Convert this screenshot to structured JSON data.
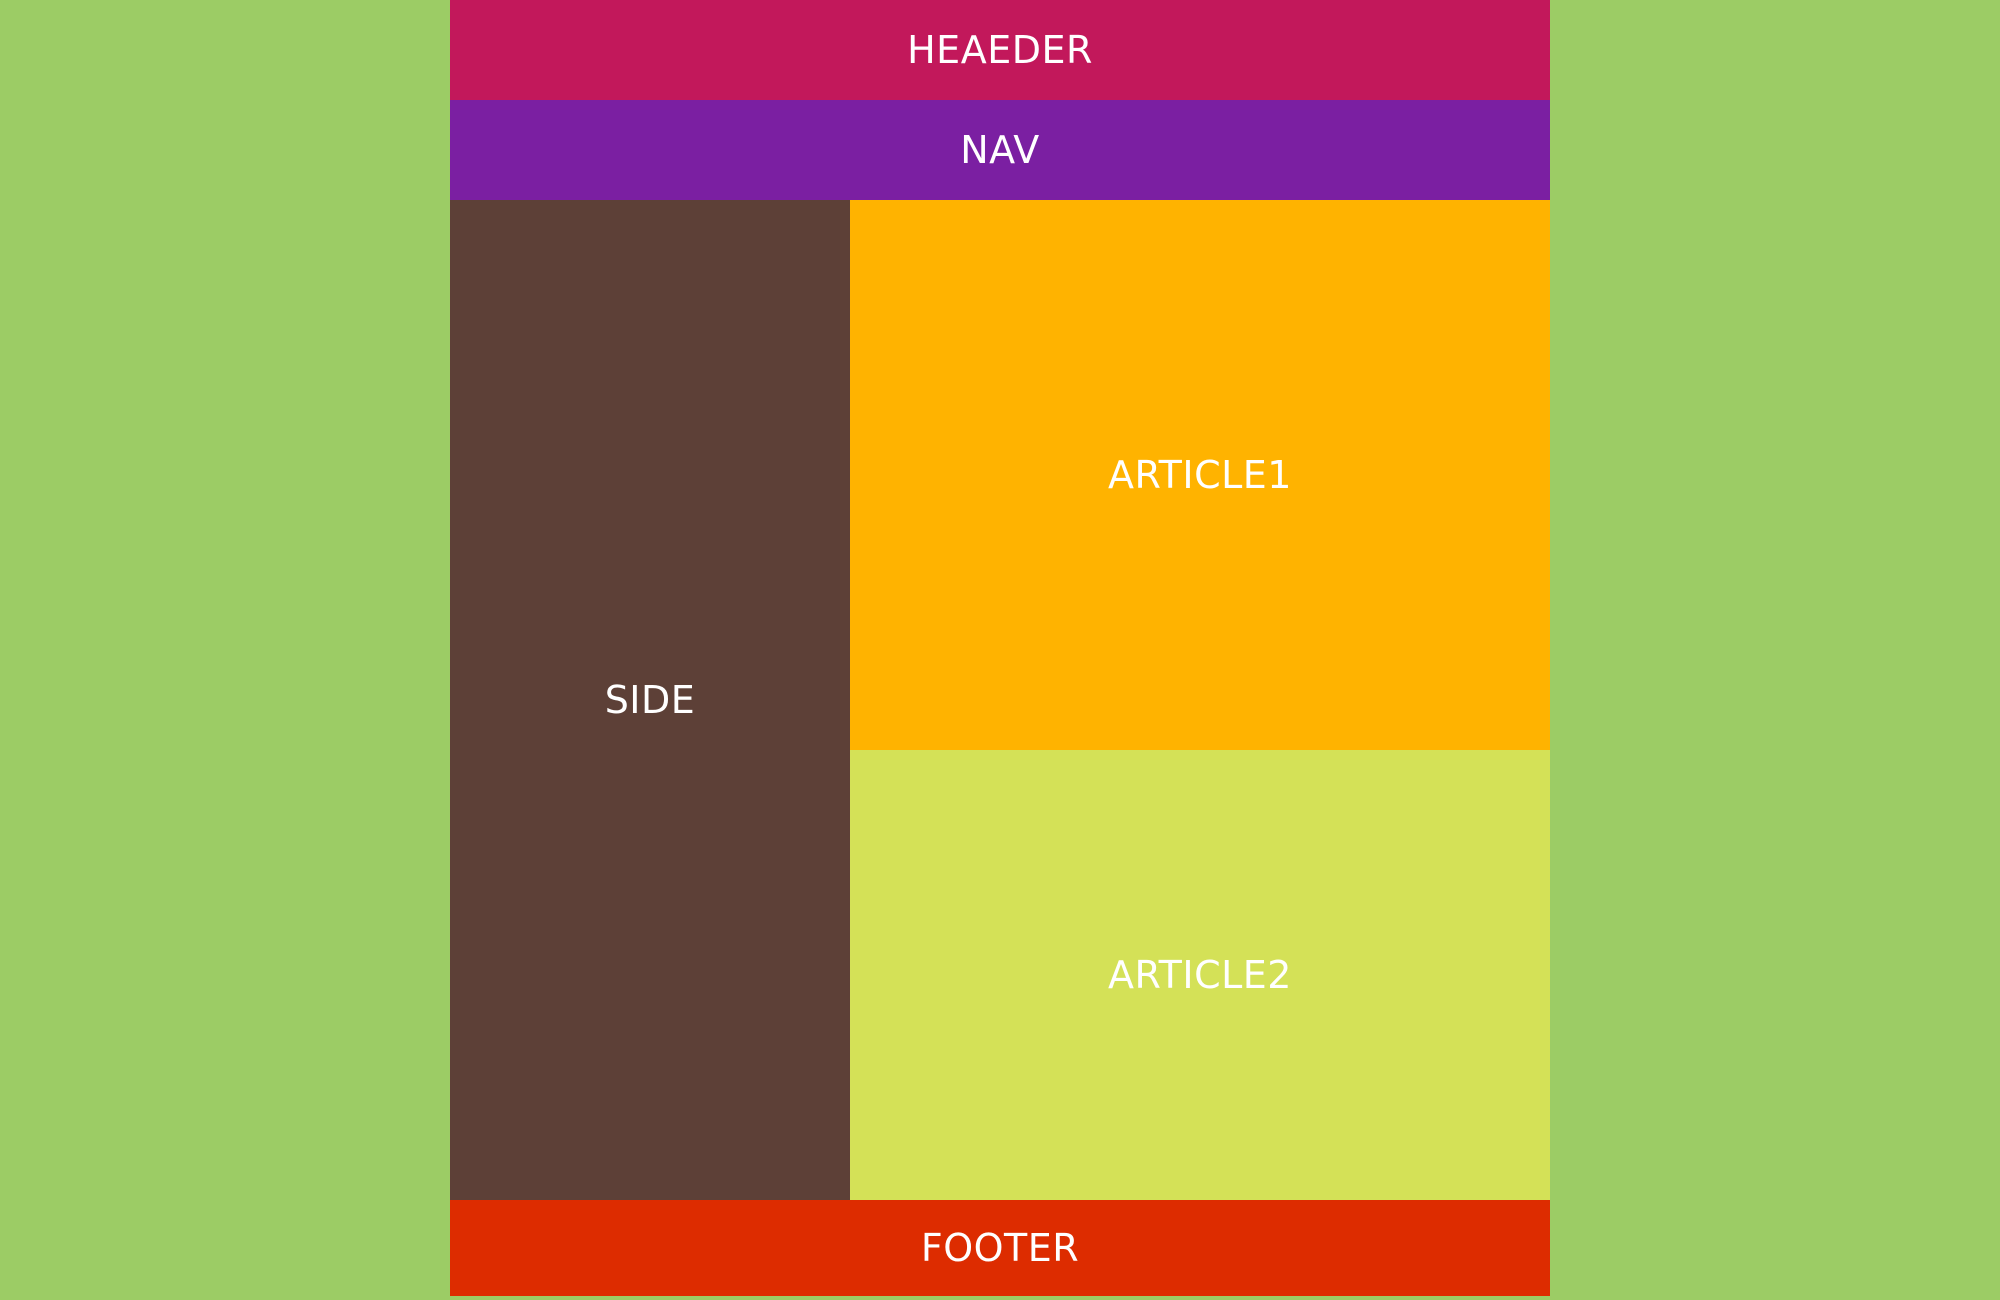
{
  "header": {
    "label": "HEAEDER",
    "color": "#c2185b"
  },
  "nav": {
    "label": "NAV",
    "color": "#7b1fa2"
  },
  "side": {
    "label": "SIDE",
    "color": "#5d4037"
  },
  "article1": {
    "label": "ARTICLE1",
    "color": "#ffb300"
  },
  "article2": {
    "label": "ARTICLE2",
    "color": "#d4e157"
  },
  "footer": {
    "label": "FOOTER",
    "color": "#dd2c00"
  },
  "page": {
    "background_color": "#9ccc65",
    "text_color": "#ffffff"
  }
}
